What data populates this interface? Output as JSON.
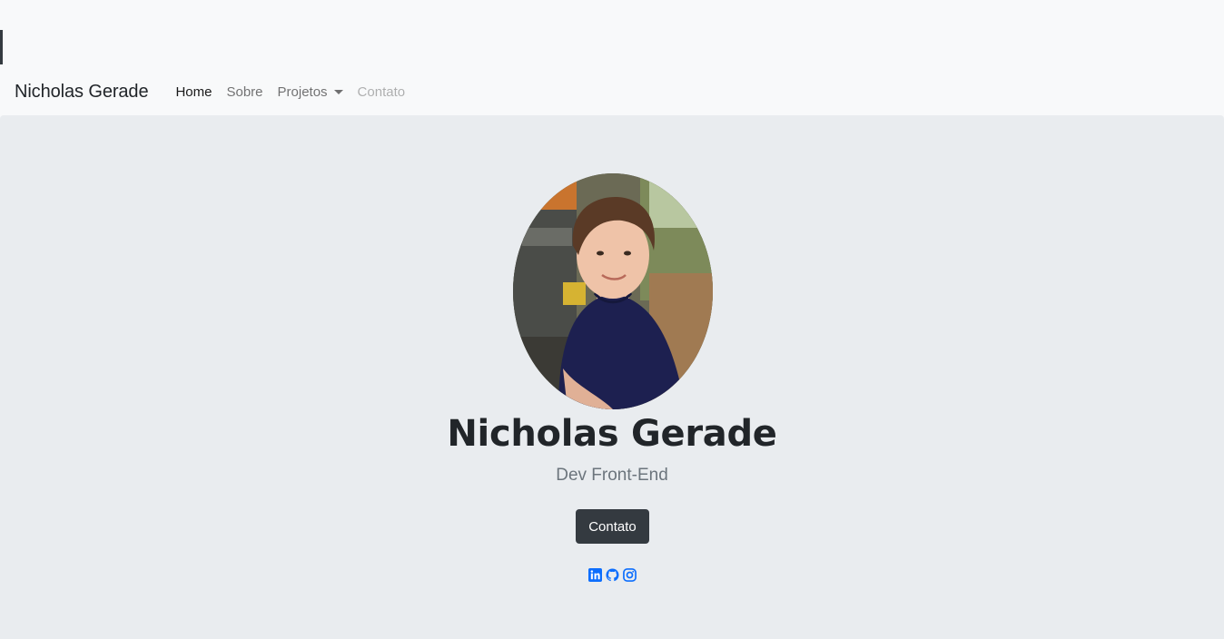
{
  "navbar": {
    "brand": "Nicholas Gerade",
    "links": [
      {
        "label": "Home",
        "state": "active"
      },
      {
        "label": "Sobre",
        "state": "normal"
      },
      {
        "label": "Projetos",
        "state": "dropdown"
      },
      {
        "label": "Contato",
        "state": "disabled"
      }
    ]
  },
  "hero": {
    "name": "Nicholas Gerade",
    "role": "Dev Front-End",
    "button_label": "Contato"
  },
  "social": {
    "icons": [
      "linkedin-icon",
      "github-icon",
      "instagram-icon"
    ]
  },
  "colors": {
    "navbar_bg": "#f8f9fa",
    "hero_bg": "#e9ecef",
    "button_bg": "#343a40",
    "icon_color": "#0d6efd"
  }
}
